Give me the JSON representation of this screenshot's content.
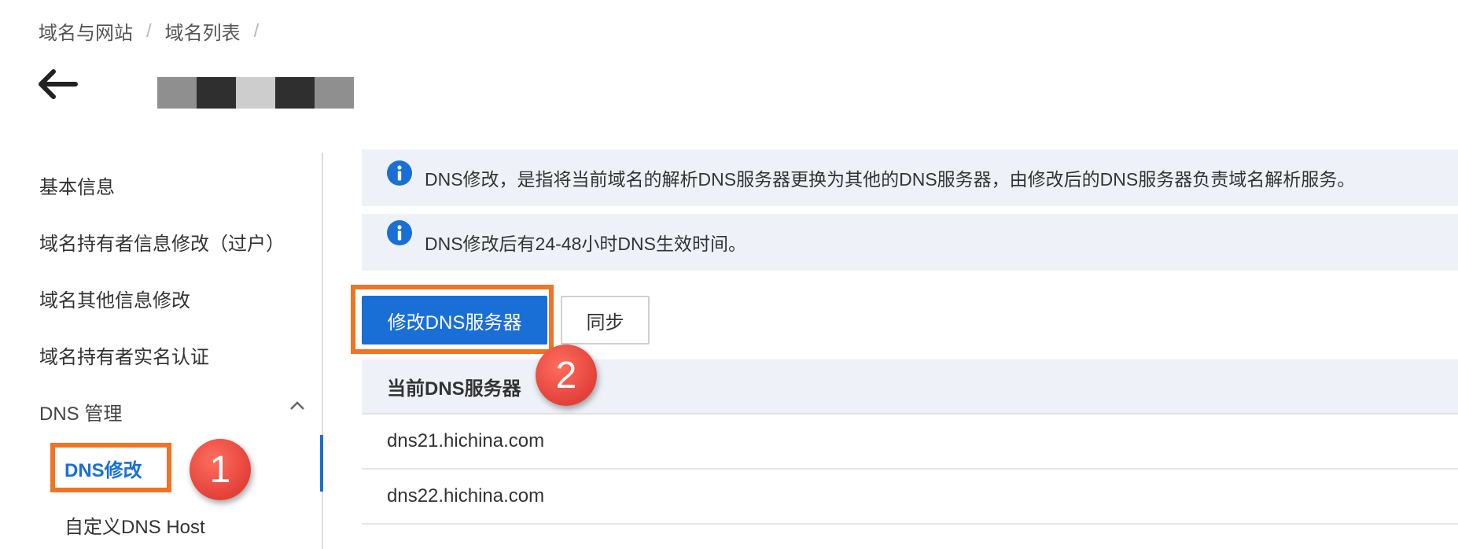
{
  "breadcrumb": [
    "域名与网站",
    "域名列表"
  ],
  "breadcrumb_sep": "/",
  "sidebar": {
    "items": [
      "基本信息",
      "域名持有者信息修改（过户）",
      "域名其他信息修改",
      "域名持有者实名认证"
    ],
    "group_label": "DNS 管理",
    "sub_items": [
      "DNS修改",
      "自定义DNS Host"
    ]
  },
  "notices": [
    "DNS修改，是指将当前域名的解析DNS服务器更换为其他的DNS服务器，由修改后的DNS服务器负责域名解析服务。",
    "DNS修改后有24-48小时DNS生效时间。"
  ],
  "buttons": {
    "modify": "修改DNS服务器",
    "sync": "同步"
  },
  "table": {
    "header": "当前DNS服务器",
    "rows": [
      "dns21.hichina.com",
      "dns22.hichina.com"
    ]
  },
  "steps": [
    "1",
    "2"
  ],
  "colors": {
    "accent": "#1a6fd6",
    "highlight": "#f27323",
    "step_badge": "#e2413a",
    "notice_bg": "#eef2f8"
  },
  "icons": {
    "back": "arrow-left-icon",
    "info": "info-icon",
    "group_toggle": "chevron-up-icon"
  }
}
